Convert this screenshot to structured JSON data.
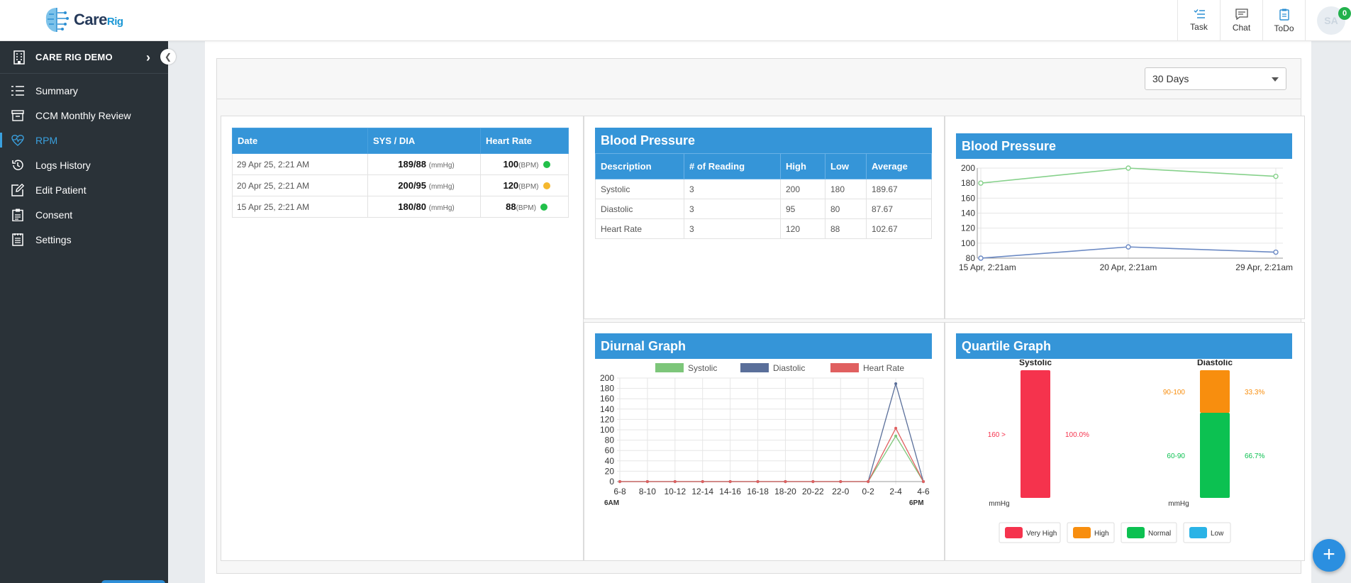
{
  "app": {
    "brand_main": "Care",
    "brand_sub": "Rig"
  },
  "top_actions": [
    {
      "label": "Task",
      "icon": "task-list-icon"
    },
    {
      "label": "Chat",
      "icon": "chat-icon"
    },
    {
      "label": "ToDo",
      "icon": "clipboard-icon"
    }
  ],
  "user": {
    "initials": "SA",
    "notification_count": "0"
  },
  "sidebar": {
    "org_name": "CARE RIG DEMO",
    "items": [
      {
        "label": "Summary",
        "icon": "list-icon",
        "active": false
      },
      {
        "label": "CCM Monthly Review",
        "icon": "archive-icon",
        "active": false
      },
      {
        "label": "RPM",
        "icon": "heart-pulse-icon",
        "active": true
      },
      {
        "label": "Logs History",
        "icon": "history-icon",
        "active": false
      },
      {
        "label": "Edit Patient",
        "icon": "edit-icon",
        "active": false
      },
      {
        "label": "Consent",
        "icon": "consent-clipboard-icon",
        "active": false
      },
      {
        "label": "Settings",
        "icon": "settings-icon",
        "active": false
      }
    ]
  },
  "filter": {
    "range": "30 Days"
  },
  "readings": {
    "headers": [
      "Date",
      "SYS / DIA",
      "Heart Rate"
    ],
    "rows": [
      {
        "date": "29 Apr 25, 2:21 AM",
        "bp": "189/88",
        "bp_unit": "(mmHg)",
        "hr": "100",
        "hr_unit": "(BPM)",
        "status_color": "#22c04a"
      },
      {
        "date": "20 Apr 25, 2:21 AM",
        "bp": "200/95",
        "bp_unit": "(mmHg)",
        "hr": "120",
        "hr_unit": "(BPM)",
        "status_color": "#f5b82e"
      },
      {
        "date": "15 Apr 25, 2:21 AM",
        "bp": "180/80",
        "bp_unit": "(mmHg)",
        "hr": "88",
        "hr_unit": "(BPM)",
        "status_color": "#22c04a"
      }
    ]
  },
  "bp_table": {
    "title": "Blood Pressure",
    "headers": [
      "Description",
      "# of Reading",
      "High",
      "Low",
      "Average"
    ],
    "rows": [
      [
        "Systolic",
        "3",
        "200",
        "180",
        "189.67"
      ],
      [
        "Diastolic",
        "3",
        "95",
        "80",
        "87.67"
      ],
      [
        "Heart Rate",
        "3",
        "120",
        "88",
        "102.67"
      ]
    ]
  },
  "chart_data": [
    {
      "type": "line",
      "title": "Blood Pressure",
      "x": [
        "15 Apr, 2:21am",
        "20 Apr, 2:21am",
        "29 Apr, 2:21am"
      ],
      "series": [
        {
          "values": [
            180,
            200,
            189
          ],
          "color": "#86d18b"
        },
        {
          "values": [
            80,
            95,
            88
          ],
          "color": "#6c8ac4"
        }
      ],
      "ylim": [
        80,
        200
      ],
      "yticks": [
        80,
        100,
        120,
        140,
        160,
        180,
        200
      ],
      "grid": true
    },
    {
      "type": "line",
      "title": "Diurnal Graph",
      "categories": [
        "6-8",
        "8-10",
        "10-12",
        "12-14",
        "14-16",
        "16-18",
        "18-20",
        "20-22",
        "22-0",
        "0-2",
        "2-4",
        "4-6"
      ],
      "series": [
        {
          "name": "Systolic",
          "values": [
            0,
            0,
            0,
            0,
            0,
            0,
            0,
            0,
            0,
            0,
            88,
            0
          ],
          "color": "#7dc67a"
        },
        {
          "name": "Diastolic",
          "values": [
            0,
            0,
            0,
            0,
            0,
            0,
            0,
            0,
            0,
            0,
            189,
            0
          ],
          "color": "#5a6f9a"
        },
        {
          "name": "Heart Rate",
          "values": [
            0,
            0,
            0,
            0,
            0,
            0,
            0,
            0,
            0,
            0,
            103,
            0
          ],
          "color": "#e06060"
        }
      ],
      "ylim": [
        0,
        200
      ],
      "yticks": [
        0,
        20,
        40,
        60,
        80,
        100,
        120,
        140,
        160,
        180,
        200
      ],
      "x_start_label": "6AM",
      "x_end_label": "6PM",
      "legend": "top",
      "grid": true
    },
    {
      "type": "bar",
      "title": "Quartile Graph",
      "unit": "mmHg",
      "groups": [
        {
          "name": "Systolic",
          "segments": [
            {
              "range": "160 >",
              "percent": "100.0%",
              "fraction": 1.0,
              "color": "#f5334d"
            }
          ]
        },
        {
          "name": "Diastolic",
          "segments": [
            {
              "range": "90-100",
              "percent": "33.3%",
              "fraction": 0.333,
              "color": "#f88e0e"
            },
            {
              "range": "60-90",
              "percent": "66.7%",
              "fraction": 0.667,
              "color": "#0cc151"
            }
          ]
        }
      ],
      "legend": [
        {
          "label": "Very High",
          "color": "#f5334d"
        },
        {
          "label": "High",
          "color": "#f88e0e"
        },
        {
          "label": "Normal",
          "color": "#0cc151"
        },
        {
          "label": "Low",
          "color": "#2ab3e6"
        }
      ]
    }
  ]
}
